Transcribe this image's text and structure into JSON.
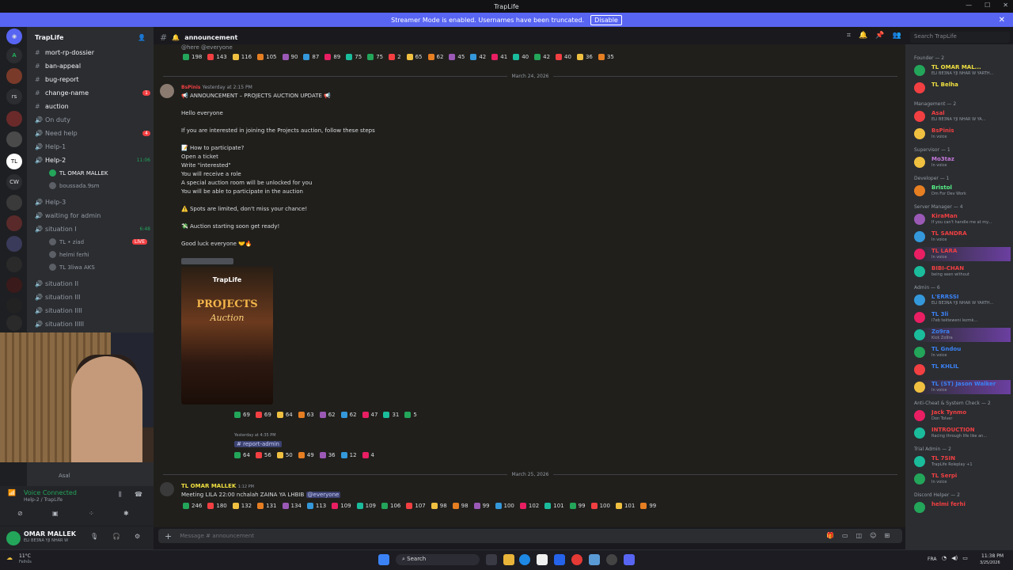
{
  "window": {
    "title": "TrapLife"
  },
  "banner": {
    "text": "Streamer Mode is enabled. Usernames have been truncated.",
    "button": "Disable"
  },
  "server": {
    "name": "TrapLife"
  },
  "channels": [
    {
      "name": "mort-rp-dossier",
      "type": "text"
    },
    {
      "name": "ban-appeal",
      "type": "text"
    },
    {
      "name": "bug-report",
      "type": "text"
    },
    {
      "name": "change-name",
      "type": "text",
      "badge": "1"
    },
    {
      "name": "auction",
      "type": "text"
    },
    {
      "name": "On duty",
      "type": "voice"
    },
    {
      "name": "Need help",
      "type": "voice",
      "badge": "4"
    },
    {
      "name": "Help-1",
      "type": "voice"
    },
    {
      "name": "Help-2",
      "type": "voice",
      "time": "11:06"
    },
    {
      "name": "Help-3",
      "type": "voice"
    },
    {
      "name": "waiting for admin",
      "type": "voice"
    },
    {
      "name": "situation I",
      "type": "voice",
      "time": "6:48"
    },
    {
      "name": "situation II",
      "type": "voice"
    },
    {
      "name": "situation III",
      "type": "voice"
    },
    {
      "name": "situation IIII",
      "type": "voice"
    },
    {
      "name": "situation IIIII",
      "type": "voice"
    }
  ],
  "voice_users": [
    {
      "name": "TL OMAR MALLEK"
    },
    {
      "name": "boussada.9sm"
    },
    {
      "name": "TL • ziad",
      "live": "LIVE"
    },
    {
      "name": "helmi ferhi"
    },
    {
      "name": "TL 3liwa AKS"
    },
    {
      "name": "Asal"
    }
  ],
  "voice": {
    "status": "Voice Connected",
    "channel": "Help-2 / TrapLife"
  },
  "user": {
    "name": "OMAR MALLEK",
    "status": "ELI BE3NA YJI NHAR W"
  },
  "channel": {
    "name": "announcement"
  },
  "search": {
    "placeholder": "Search TrapLife"
  },
  "chat": {
    "top_mention": "@here @everyone",
    "reactions_top": [
      "198",
      "143",
      "116",
      "105",
      "90",
      "87",
      "89",
      "75",
      "75",
      "2",
      "65",
      "62",
      "45",
      "42",
      "41",
      "40",
      "42",
      "40",
      "36",
      "35"
    ],
    "date1": "March 24, 2026",
    "author1": "BsPinis",
    "time1": "Yesterday at 2:15 PM",
    "lines": [
      "📢 ANNOUNCEMENT – PROJECTS AUCTION UPDATE 📢",
      "Hello everyone",
      "If you are interested in joining the Projects auction, follow these steps",
      "📝 How to participate?",
      "Open a ticket",
      "Write \"interested\"",
      "You will receive a role",
      " A special auction room will be unlocked for you",
      "You will be able to participate in the auction",
      "⚠️ Spots are limited, don't miss your chance!",
      "💸 Auction starting soon  get ready!",
      "Good luck everyone 🤝🔥"
    ],
    "poster": {
      "logo": "TrapLife",
      "title": "PROJECTS",
      "subtitle": "Auction"
    },
    "reactions_mid": [
      "69",
      "69",
      "64",
      "63",
      "62",
      "62",
      "47",
      "31",
      "5"
    ],
    "reply_time": "Yesterday at 4:35 PM",
    "reply_channel": "report-admin",
    "reactions_low": [
      "64",
      "56",
      "50",
      "49",
      "36",
      "12",
      "4"
    ],
    "date2": "March 25, 2026",
    "author2": "TL OMAR MALLEK",
    "time2": "1:12 PM",
    "msg2": "Meeting LILA 22:00 nchalah ZAINA YA LHBIB",
    "mention2": "@everyone",
    "reactions_bottom": [
      "246",
      "180",
      "132",
      "131",
      "134",
      "113",
      "109",
      "109",
      "106",
      "107",
      "98",
      "98",
      "99",
      "100",
      "102",
      "101",
      "99",
      "100",
      "101",
      "99"
    ]
  },
  "composer": {
    "placeholder": "Message #  announcement"
  },
  "members": {
    "categories": [
      {
        "name": "Founder — 2",
        "users": [
          {
            "name": "TL OMAR MAL...",
            "status": "ELI BE3NA YJI NHAR W YARTH...",
            "color": "#f0e040"
          },
          {
            "name": "TL Belha",
            "status": "",
            "color": "#f0e040"
          }
        ]
      },
      {
        "name": "Management — 2",
        "users": [
          {
            "name": "Asal",
            "status": "ELI BE3NA YJI NHAR W YA...",
            "color": "#f23f42"
          },
          {
            "name": "BsPinis",
            "status": "In voice",
            "color": "#f23f42"
          }
        ]
      },
      {
        "name": "Supervisor — 1",
        "users": [
          {
            "name": "Mo3taz",
            "status": "In voice",
            "color": "#c678dd"
          }
        ]
      },
      {
        "name": "Developer — 1",
        "users": [
          {
            "name": "Bristol",
            "status": "Dm For Dev Work",
            "color": "#57f287"
          }
        ]
      },
      {
        "name": "Server Manager — 4",
        "users": [
          {
            "name": "KiraMan",
            "status": "If you can't handle me at my...",
            "color": "#f23f42"
          },
          {
            "name": "TL SANDRA",
            "status": "In voice",
            "color": "#f23f42"
          },
          {
            "name": "TL LARA",
            "status": "In voice",
            "color": "#f23f42"
          },
          {
            "name": "BIBI-CHAN",
            "status": "being seen without",
            "color": "#f23f42"
          }
        ]
      },
      {
        "name": "Admin — 6",
        "users": [
          {
            "name": "L'ERRSSI",
            "status": "ELI BE3NA YJI NHAR W YARTH...",
            "color": "#3b82f6"
          },
          {
            "name": "TL 3li",
            "status": "i7eb tekteweni lezmk...",
            "color": "#3b82f6"
          },
          {
            "name": "Zo9ra",
            "status": "Kick Zo9ra",
            "color": "#3b82f6"
          },
          {
            "name": "TL Gndou",
            "status": "In voice",
            "color": "#3b82f6"
          },
          {
            "name": "TL KHLIL",
            "status": "",
            "color": "#3b82f6"
          },
          {
            "name": "TL (ST) Jason Walker",
            "status": "In voice",
            "color": "#3b82f6"
          }
        ]
      },
      {
        "name": "Anti-Cheat & System Check — 2",
        "users": [
          {
            "name": "Jack Tynmo",
            "status": "Don Tolver",
            "color": "#f23f42"
          },
          {
            "name": "INTROUCTION",
            "status": "Racing through life like an...",
            "color": "#f23f42"
          }
        ]
      },
      {
        "name": "Trial Admin — 2",
        "users": [
          {
            "name": "TL 7SIN",
            "status": "TrapLife Roleplay +1",
            "color": "#f23f42"
          },
          {
            "name": "TL Serpi",
            "status": "In voice",
            "color": "#f23f42"
          }
        ]
      },
      {
        "name": "Discord Helper — 2",
        "users": [
          {
            "name": "helmi ferhi",
            "status": "",
            "color": "#f23f42"
          }
        ]
      }
    ]
  },
  "taskbar": {
    "search": "Search",
    "weather": "11°C",
    "weather_desc": "Felhős",
    "lang": "FRA",
    "time": "11:38 PM",
    "date": "3/25/2026"
  }
}
